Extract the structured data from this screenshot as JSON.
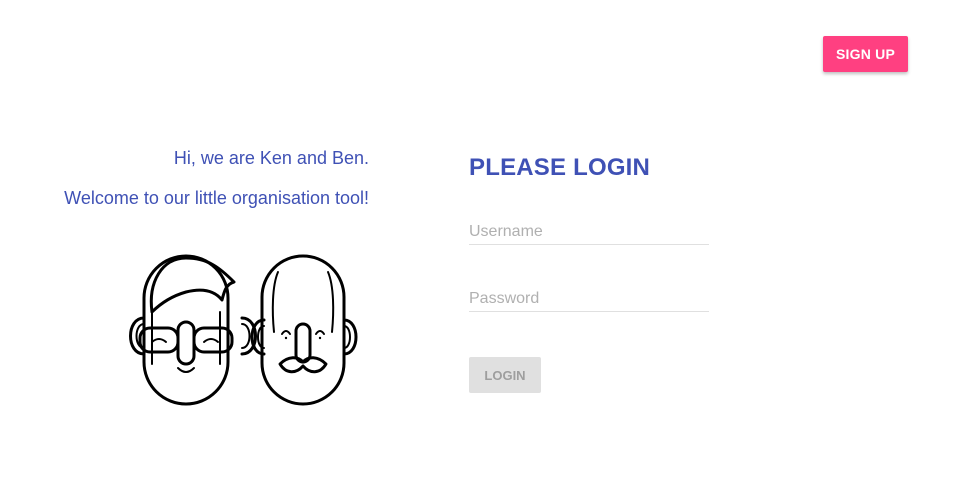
{
  "header": {
    "signup_label": "SIGN UP",
    "accent_color": "#ff4081"
  },
  "welcome": {
    "line1": "Hi, we are Ken and Ben.",
    "line2": "Welcome to our little organisation tool!"
  },
  "login": {
    "title": "PLEASE LOGIN",
    "username_placeholder": "Username",
    "password_placeholder": "Password",
    "button_label": "LOGIN",
    "title_color": "#3f51b5"
  },
  "illustration": {
    "icon": "ken-and-ben-faces-icon"
  }
}
